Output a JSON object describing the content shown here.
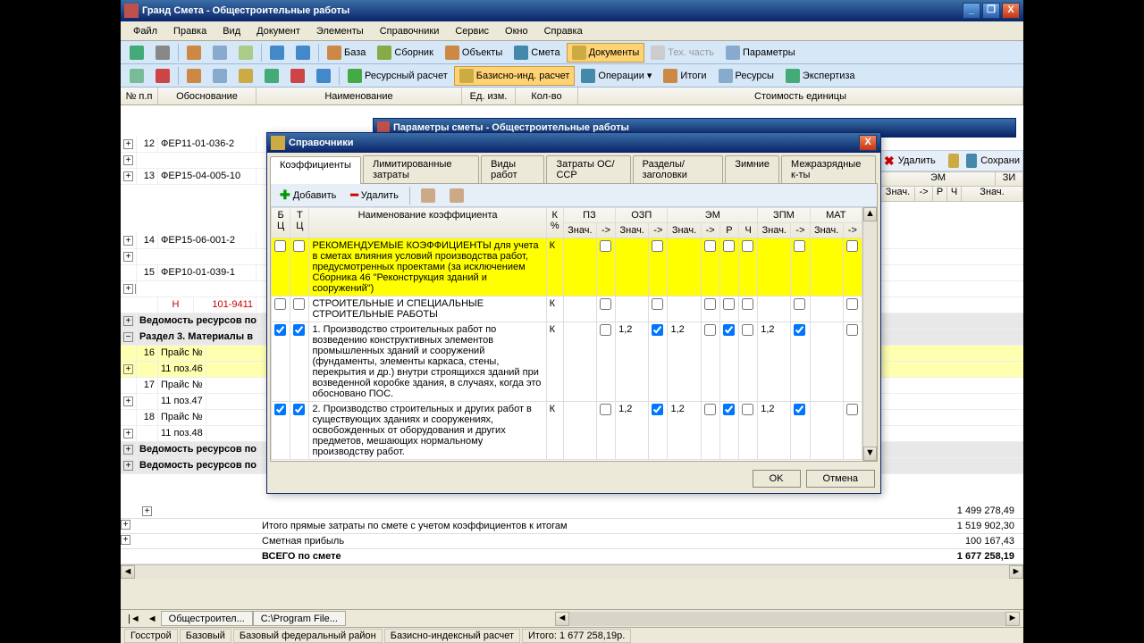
{
  "app": {
    "title": "Гранд Смета - Общестроительные работы",
    "menu": [
      "Файл",
      "Правка",
      "Вид",
      "Документ",
      "Элементы",
      "Справочники",
      "Сервис",
      "Окно",
      "Справка"
    ],
    "tb2": {
      "baza": "База",
      "sbornik": "Сборник",
      "objekty": "Объекты",
      "smeta": "Смета",
      "docs": "Документы",
      "tech": "Тех. часть",
      "params": "Параметры"
    },
    "tb3": {
      "res": "Ресурсный расчет",
      "baz": "Базисно-инд. расчет",
      "oper": "Операции",
      "itogi": "Итоги",
      "resursy": "Ресурсы",
      "expert": "Экспертиза"
    },
    "gridhead": {
      "npp": "№\\nп.п",
      "obosn": "Обоснование",
      "naim": "Наименование",
      "ed": "Ед. изм.",
      "kolvo": "Кол-во",
      "stoim": "Стоимость единицы"
    },
    "rtoolbar": {
      "del": "Удалить",
      "save": "Сохрани"
    },
    "rcols": {
      "em": "ЭМ",
      "znach": "Знач.",
      "arrow": "->",
      "r": "Р",
      "ch": "Ч",
      "zi": "ЗИ"
    }
  },
  "bgdialog": {
    "title": "Параметры сметы - Общестроительные работы"
  },
  "rows": [
    {
      "n": "12",
      "code": "ФЕР11-01-036-2"
    },
    {
      "n": "13",
      "code": "ФЕР15-04-005-10"
    },
    {
      "n": "14",
      "code": "ФЕР15-06-001-2"
    },
    {
      "n": "15",
      "code": "ФЕР10-01-039-1"
    }
  ],
  "redrow": {
    "label": "Н",
    "code": "101-9411"
  },
  "sections": [
    "Ведомость ресурсов по",
    "Раздел 3. Материалы в"
  ],
  "prices": [
    {
      "n": "16",
      "a": "Прайс №",
      "b": "11 поз.46"
    },
    {
      "n": "17",
      "a": "Прайс №",
      "b": "11 поз.47"
    },
    {
      "n": "18",
      "a": "Прайс №",
      "b": "11 поз.48"
    }
  ],
  "sections2": [
    "Ведомость ресурсов по",
    "Ведомость ресурсов по"
  ],
  "totals": [
    {
      "label": "Итого прямые затраты по смете с учетом коэффициентов к итогам",
      "val": "1 519 902,30"
    },
    {
      "label": "Сметная прибыль",
      "val": "100 167,43"
    }
  ],
  "pretotal": {
    "val": "1 499 278,49"
  },
  "grandtotal": {
    "label": "ВСЕГО по смете",
    "val": "1 677 258,19"
  },
  "btabs": [
    "Общестроител...",
    "C:\\Program File..."
  ],
  "status": [
    "Госстрой",
    "Базовый",
    "Базовый федеральный район",
    "Базисно-индексный расчет",
    "Итого: 1 677 258,19р."
  ],
  "modal": {
    "title": "Справочники",
    "tabs": [
      "Коэффициенты",
      "Лимитированные затраты",
      "Виды работ",
      "Затраты ОС/ССР",
      "Разделы/заголовки",
      "Зимние",
      "Межразрядные к-ты"
    ],
    "add": "Добавить",
    "del": "Удалить",
    "head": {
      "bc": "Б\\nЦ",
      "tc": "Т\\nЦ",
      "name": "Наименование коэффициента",
      "kp": "К\\n%",
      "pz": "ПЗ",
      "ozp": "ОЗП",
      "em": "ЭМ",
      "zpm": "ЗПМ",
      "mat": "МАТ",
      "znach": "Знач.",
      "arrow": "->",
      "r": "Р",
      "ch": "Ч"
    },
    "items": [
      {
        "hl": true,
        "text": "РЕКОМЕНДУЕМЫЕ КОЭФФИЦИЕНТЫ для учета в сметах влияния условий производства работ, предусмотренных проектами (за исключением Сборника 46 \"Реконструкция зданий и сооружений\")",
        "k": "К"
      },
      {
        "text": "СТРОИТЕЛЬНЫЕ И СПЕЦИАЛЬНЫЕ СТРОИТЕЛЬНЫЕ РАБОТЫ",
        "k": "К"
      },
      {
        "checked": true,
        "text": "1. Производство строительных работ по возведению конструктивных элементов промышленных зданий и сооружений (фундаменты, элементы каркаса, стены, перекрытия и др.) внутри строящихся зданий при возведенной коробке здания, в случаях, когда это обосновано ПОС.",
        "k": "К",
        "ozp": "1,2",
        "em": "1,2",
        "emchk": true,
        "zpm": "1,2"
      },
      {
        "checked": true,
        "text": "2. Производство строительных и других работ в существующих зданиях и сооружениях, освобожденных от оборудования и других предметов, мешающих нормальному производству работ.",
        "k": "К",
        "ozp": "1,2",
        "em": "1,2",
        "emchk": true,
        "zpm": "1,2"
      }
    ],
    "ok": "OK",
    "cancel": "Отмена"
  }
}
